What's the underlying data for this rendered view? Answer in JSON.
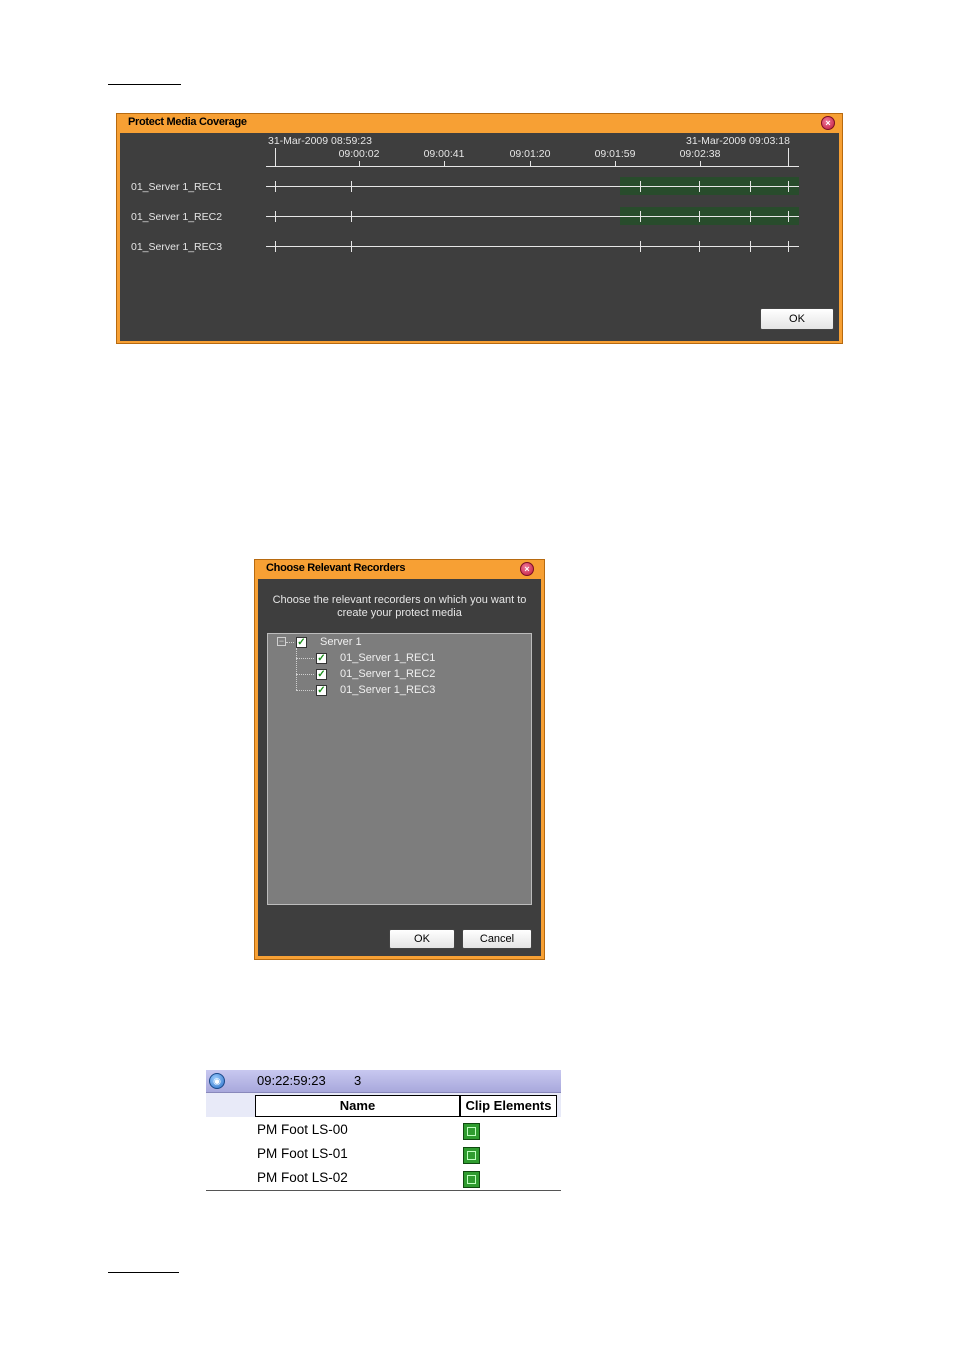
{
  "coverage_dialog": {
    "title": "Protect Media Coverage",
    "start_label": "31-Mar-2009 08:59:23",
    "end_label": "31-Mar-2009 09:03:18",
    "tick_labels": [
      "09:00:02",
      "09:00:41",
      "09:01:20",
      "09:01:59",
      "09:02:38"
    ],
    "rows": [
      {
        "label": "01_Server 1_REC1"
      },
      {
        "label": "01_Server 1_REC2"
      },
      {
        "label": "01_Server 1_REC3"
      }
    ],
    "ok_label": "OK",
    "coverage_color": "#284c2c"
  },
  "recorders_dialog": {
    "title": "Choose Relevant Recorders",
    "instruction_line1": "Choose the relevant recorders on which you want to",
    "instruction_line2": "create your protect media",
    "server": {
      "label": "Server 1",
      "checked": true
    },
    "recorders": [
      {
        "label": "01_Server 1_REC1",
        "checked": true
      },
      {
        "label": "01_Server 1_REC2",
        "checked": true
      },
      {
        "label": "01_Server 1_REC3",
        "checked": true
      }
    ],
    "ok_label": "OK",
    "cancel_label": "Cancel"
  },
  "clip_list": {
    "timecode": "09:22:59:23",
    "count": "3",
    "columns": [
      "Name",
      "Clip Elements"
    ],
    "rows": [
      {
        "name": "PM Foot LS-00",
        "icon": "clip-element-icon"
      },
      {
        "name": "PM Foot LS-01",
        "icon": "clip-element-icon"
      },
      {
        "name": "PM Foot LS-02",
        "icon": "clip-element-icon"
      }
    ]
  },
  "colors": {
    "dialog_frame": "#f7a034",
    "dialog_body": "#3e3e3e",
    "tree_bg": "#7d7d7d",
    "list_header": "#b8b8e6"
  }
}
